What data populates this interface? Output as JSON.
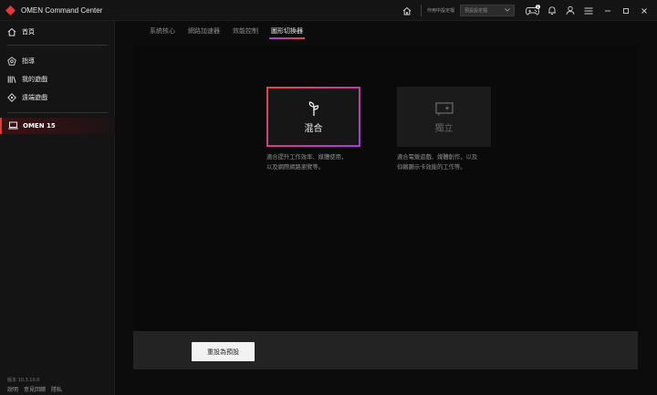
{
  "app": {
    "title": "OMEN Command Center"
  },
  "titlebar": {
    "preset_label": "作用中設定檔",
    "preset_value": "預設設定檔",
    "notification_count": "1"
  },
  "sidebar": {
    "items": [
      {
        "label": "首頁",
        "icon": "home-icon"
      },
      {
        "label": "指導",
        "icon": "coach-icon"
      },
      {
        "label": "我的遊戲",
        "icon": "library-icon"
      },
      {
        "label": "遠端遊戲",
        "icon": "remote-play-icon"
      }
    ],
    "device": "OMEN 15",
    "version": "版本 10.3.10.0",
    "footer": [
      "說明",
      "意見回饋",
      "隱私"
    ]
  },
  "tabs": [
    "系統核心",
    "網路加速器",
    "效能控制",
    "圖形切換器"
  ],
  "active_tab": 3,
  "modes": [
    {
      "label": "混合",
      "icon": "hybrid-icon",
      "desc": [
        "適合提升工作效率、媒體使用，",
        "以及網際網路瀏覽等。"
      ],
      "selected": true
    },
    {
      "label": "獨立",
      "icon": "discrete-icon",
      "desc": [
        "適合電競遊戲、媒體創作，以及",
        "仰賴顯示卡效能的工作等。"
      ],
      "selected": false
    }
  ],
  "reset_button": "重設為預設",
  "colors": {
    "accent_red": "#e8454a",
    "accent_purple": "#a83ad8"
  }
}
